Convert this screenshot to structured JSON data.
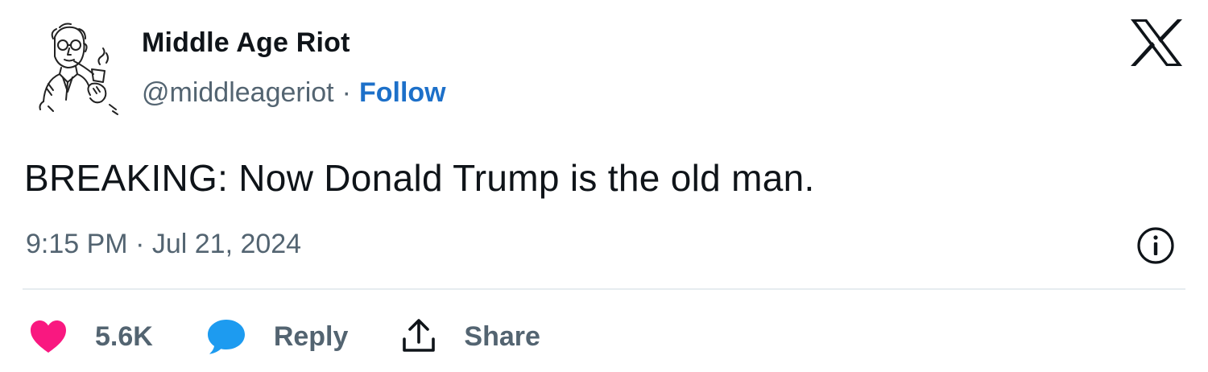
{
  "author": {
    "display_name": "Middle Age Riot",
    "handle": "@middleageriot",
    "separator": "·",
    "follow_label": "Follow",
    "avatar_icon": "vintage-pipe-smoker-avatar"
  },
  "brand": {
    "logo_icon": "x-logo-icon"
  },
  "tweet": {
    "text": "BREAKING: Now Donald Trump is the old man.",
    "timestamp": "9:15 PM · Jul 21, 2024",
    "info_icon": "info-icon"
  },
  "actions": {
    "like": {
      "icon": "heart-icon",
      "count": "5.6K",
      "color": "#f91880"
    },
    "reply": {
      "icon": "speech-bubble-icon",
      "label": "Reply",
      "color": "#1d9bf0"
    },
    "share": {
      "icon": "share-upload-icon",
      "label": "Share"
    }
  },
  "colors": {
    "text_primary": "#0f1419",
    "text_secondary": "#536471",
    "link": "#1d70c9",
    "divider": "#e6ecf0"
  }
}
